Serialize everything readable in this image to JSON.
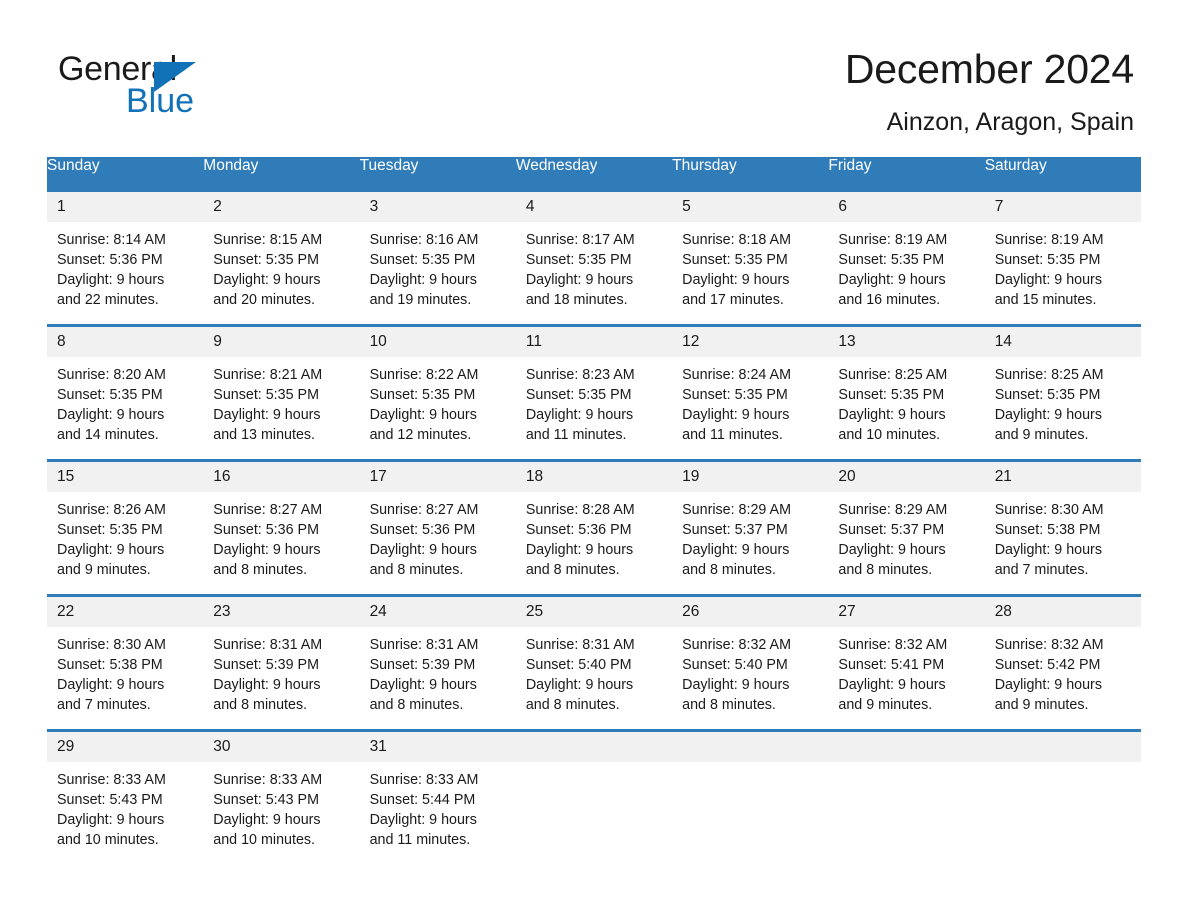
{
  "brand": {
    "name_part1": "General",
    "name_part2": "Blue",
    "triangle_icon": "brand-triangle-icon",
    "accent_color": "#1272b8"
  },
  "header": {
    "title": "December 2024",
    "subtitle": "Ainzon, Aragon, Spain"
  },
  "theme": {
    "header_blue": "#2f7cb9",
    "daynum_gray": "#f1f1f1",
    "text_color": "#1a1a1a"
  },
  "calendar": {
    "weekday_headers": [
      "Sunday",
      "Monday",
      "Tuesday",
      "Wednesday",
      "Thursday",
      "Friday",
      "Saturday"
    ],
    "weeks": [
      [
        {
          "day": "1",
          "sunrise": "Sunrise: 8:14 AM",
          "sunset": "Sunset: 5:36 PM",
          "daylight_line1": "Daylight: 9 hours",
          "daylight_line2": "and 22 minutes."
        },
        {
          "day": "2",
          "sunrise": "Sunrise: 8:15 AM",
          "sunset": "Sunset: 5:35 PM",
          "daylight_line1": "Daylight: 9 hours",
          "daylight_line2": "and 20 minutes."
        },
        {
          "day": "3",
          "sunrise": "Sunrise: 8:16 AM",
          "sunset": "Sunset: 5:35 PM",
          "daylight_line1": "Daylight: 9 hours",
          "daylight_line2": "and 19 minutes."
        },
        {
          "day": "4",
          "sunrise": "Sunrise: 8:17 AM",
          "sunset": "Sunset: 5:35 PM",
          "daylight_line1": "Daylight: 9 hours",
          "daylight_line2": "and 18 minutes."
        },
        {
          "day": "5",
          "sunrise": "Sunrise: 8:18 AM",
          "sunset": "Sunset: 5:35 PM",
          "daylight_line1": "Daylight: 9 hours",
          "daylight_line2": "and 17 minutes."
        },
        {
          "day": "6",
          "sunrise": "Sunrise: 8:19 AM",
          "sunset": "Sunset: 5:35 PM",
          "daylight_line1": "Daylight: 9 hours",
          "daylight_line2": "and 16 minutes."
        },
        {
          "day": "7",
          "sunrise": "Sunrise: 8:19 AM",
          "sunset": "Sunset: 5:35 PM",
          "daylight_line1": "Daylight: 9 hours",
          "daylight_line2": "and 15 minutes."
        }
      ],
      [
        {
          "day": "8",
          "sunrise": "Sunrise: 8:20 AM",
          "sunset": "Sunset: 5:35 PM",
          "daylight_line1": "Daylight: 9 hours",
          "daylight_line2": "and 14 minutes."
        },
        {
          "day": "9",
          "sunrise": "Sunrise: 8:21 AM",
          "sunset": "Sunset: 5:35 PM",
          "daylight_line1": "Daylight: 9 hours",
          "daylight_line2": "and 13 minutes."
        },
        {
          "day": "10",
          "sunrise": "Sunrise: 8:22 AM",
          "sunset": "Sunset: 5:35 PM",
          "daylight_line1": "Daylight: 9 hours",
          "daylight_line2": "and 12 minutes."
        },
        {
          "day": "11",
          "sunrise": "Sunrise: 8:23 AM",
          "sunset": "Sunset: 5:35 PM",
          "daylight_line1": "Daylight: 9 hours",
          "daylight_line2": "and 11 minutes."
        },
        {
          "day": "12",
          "sunrise": "Sunrise: 8:24 AM",
          "sunset": "Sunset: 5:35 PM",
          "daylight_line1": "Daylight: 9 hours",
          "daylight_line2": "and 11 minutes."
        },
        {
          "day": "13",
          "sunrise": "Sunrise: 8:25 AM",
          "sunset": "Sunset: 5:35 PM",
          "daylight_line1": "Daylight: 9 hours",
          "daylight_line2": "and 10 minutes."
        },
        {
          "day": "14",
          "sunrise": "Sunrise: 8:25 AM",
          "sunset": "Sunset: 5:35 PM",
          "daylight_line1": "Daylight: 9 hours",
          "daylight_line2": "and 9 minutes."
        }
      ],
      [
        {
          "day": "15",
          "sunrise": "Sunrise: 8:26 AM",
          "sunset": "Sunset: 5:35 PM",
          "daylight_line1": "Daylight: 9 hours",
          "daylight_line2": "and 9 minutes."
        },
        {
          "day": "16",
          "sunrise": "Sunrise: 8:27 AM",
          "sunset": "Sunset: 5:36 PM",
          "daylight_line1": "Daylight: 9 hours",
          "daylight_line2": "and 8 minutes."
        },
        {
          "day": "17",
          "sunrise": "Sunrise: 8:27 AM",
          "sunset": "Sunset: 5:36 PM",
          "daylight_line1": "Daylight: 9 hours",
          "daylight_line2": "and 8 minutes."
        },
        {
          "day": "18",
          "sunrise": "Sunrise: 8:28 AM",
          "sunset": "Sunset: 5:36 PM",
          "daylight_line1": "Daylight: 9 hours",
          "daylight_line2": "and 8 minutes."
        },
        {
          "day": "19",
          "sunrise": "Sunrise: 8:29 AM",
          "sunset": "Sunset: 5:37 PM",
          "daylight_line1": "Daylight: 9 hours",
          "daylight_line2": "and 8 minutes."
        },
        {
          "day": "20",
          "sunrise": "Sunrise: 8:29 AM",
          "sunset": "Sunset: 5:37 PM",
          "daylight_line1": "Daylight: 9 hours",
          "daylight_line2": "and 8 minutes."
        },
        {
          "day": "21",
          "sunrise": "Sunrise: 8:30 AM",
          "sunset": "Sunset: 5:38 PM",
          "daylight_line1": "Daylight: 9 hours",
          "daylight_line2": "and 7 minutes."
        }
      ],
      [
        {
          "day": "22",
          "sunrise": "Sunrise: 8:30 AM",
          "sunset": "Sunset: 5:38 PM",
          "daylight_line1": "Daylight: 9 hours",
          "daylight_line2": "and 7 minutes."
        },
        {
          "day": "23",
          "sunrise": "Sunrise: 8:31 AM",
          "sunset": "Sunset: 5:39 PM",
          "daylight_line1": "Daylight: 9 hours",
          "daylight_line2": "and 8 minutes."
        },
        {
          "day": "24",
          "sunrise": "Sunrise: 8:31 AM",
          "sunset": "Sunset: 5:39 PM",
          "daylight_line1": "Daylight: 9 hours",
          "daylight_line2": "and 8 minutes."
        },
        {
          "day": "25",
          "sunrise": "Sunrise: 8:31 AM",
          "sunset": "Sunset: 5:40 PM",
          "daylight_line1": "Daylight: 9 hours",
          "daylight_line2": "and 8 minutes."
        },
        {
          "day": "26",
          "sunrise": "Sunrise: 8:32 AM",
          "sunset": "Sunset: 5:40 PM",
          "daylight_line1": "Daylight: 9 hours",
          "daylight_line2": "and 8 minutes."
        },
        {
          "day": "27",
          "sunrise": "Sunrise: 8:32 AM",
          "sunset": "Sunset: 5:41 PM",
          "daylight_line1": "Daylight: 9 hours",
          "daylight_line2": "and 9 minutes."
        },
        {
          "day": "28",
          "sunrise": "Sunrise: 8:32 AM",
          "sunset": "Sunset: 5:42 PM",
          "daylight_line1": "Daylight: 9 hours",
          "daylight_line2": "and 9 minutes."
        }
      ],
      [
        {
          "day": "29",
          "sunrise": "Sunrise: 8:33 AM",
          "sunset": "Sunset: 5:43 PM",
          "daylight_line1": "Daylight: 9 hours",
          "daylight_line2": "and 10 minutes."
        },
        {
          "day": "30",
          "sunrise": "Sunrise: 8:33 AM",
          "sunset": "Sunset: 5:43 PM",
          "daylight_line1": "Daylight: 9 hours",
          "daylight_line2": "and 10 minutes."
        },
        {
          "day": "31",
          "sunrise": "Sunrise: 8:33 AM",
          "sunset": "Sunset: 5:44 PM",
          "daylight_line1": "Daylight: 9 hours",
          "daylight_line2": "and 11 minutes."
        },
        {
          "day": "",
          "sunrise": "",
          "sunset": "",
          "daylight_line1": "",
          "daylight_line2": ""
        },
        {
          "day": "",
          "sunrise": "",
          "sunset": "",
          "daylight_line1": "",
          "daylight_line2": ""
        },
        {
          "day": "",
          "sunrise": "",
          "sunset": "",
          "daylight_line1": "",
          "daylight_line2": ""
        },
        {
          "day": "",
          "sunrise": "",
          "sunset": "",
          "daylight_line1": "",
          "daylight_line2": ""
        }
      ]
    ]
  }
}
